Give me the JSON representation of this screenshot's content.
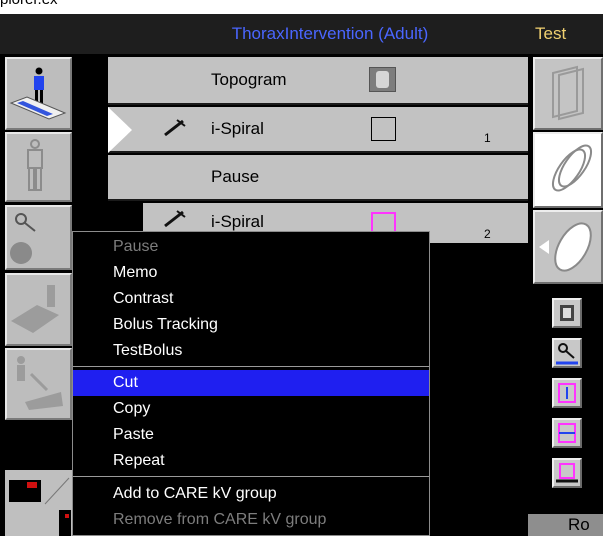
{
  "header": {
    "partial_text": "plorer.ex",
    "protocol_title": "ThoraxIntervention (Adult)",
    "mode_label": "Test"
  },
  "scan_list": [
    {
      "label": "Topogram",
      "index": ""
    },
    {
      "label": "i-Spiral",
      "index": "1"
    },
    {
      "label": "Pause",
      "index": ""
    },
    {
      "label": "i-Spiral",
      "index": "2"
    }
  ],
  "context_menu": {
    "items": [
      {
        "label": "Pause",
        "enabled": false
      },
      {
        "label": "Memo",
        "enabled": true
      },
      {
        "label": "Contrast",
        "enabled": true
      },
      {
        "label": "Bolus Tracking",
        "enabled": true
      },
      {
        "label": "TestBolus",
        "enabled": true
      },
      {
        "label": "Cut",
        "enabled": true,
        "highlighted": true
      },
      {
        "label": "Copy",
        "enabled": true
      },
      {
        "label": "Paste",
        "enabled": true
      },
      {
        "label": "Repeat",
        "enabled": true
      },
      {
        "label": "Add to CARE kV group",
        "enabled": true
      },
      {
        "label": "Remove from CARE kV group",
        "enabled": false
      }
    ]
  },
  "right_panel": {
    "bottom_label": "Ro"
  },
  "colors": {
    "title_blue": "#4a66ff",
    "mode_yellow": "#f0d070",
    "highlight": "#1f1ff0",
    "row_gray": "#c2c2c2",
    "magenta": "#ff33ff"
  }
}
